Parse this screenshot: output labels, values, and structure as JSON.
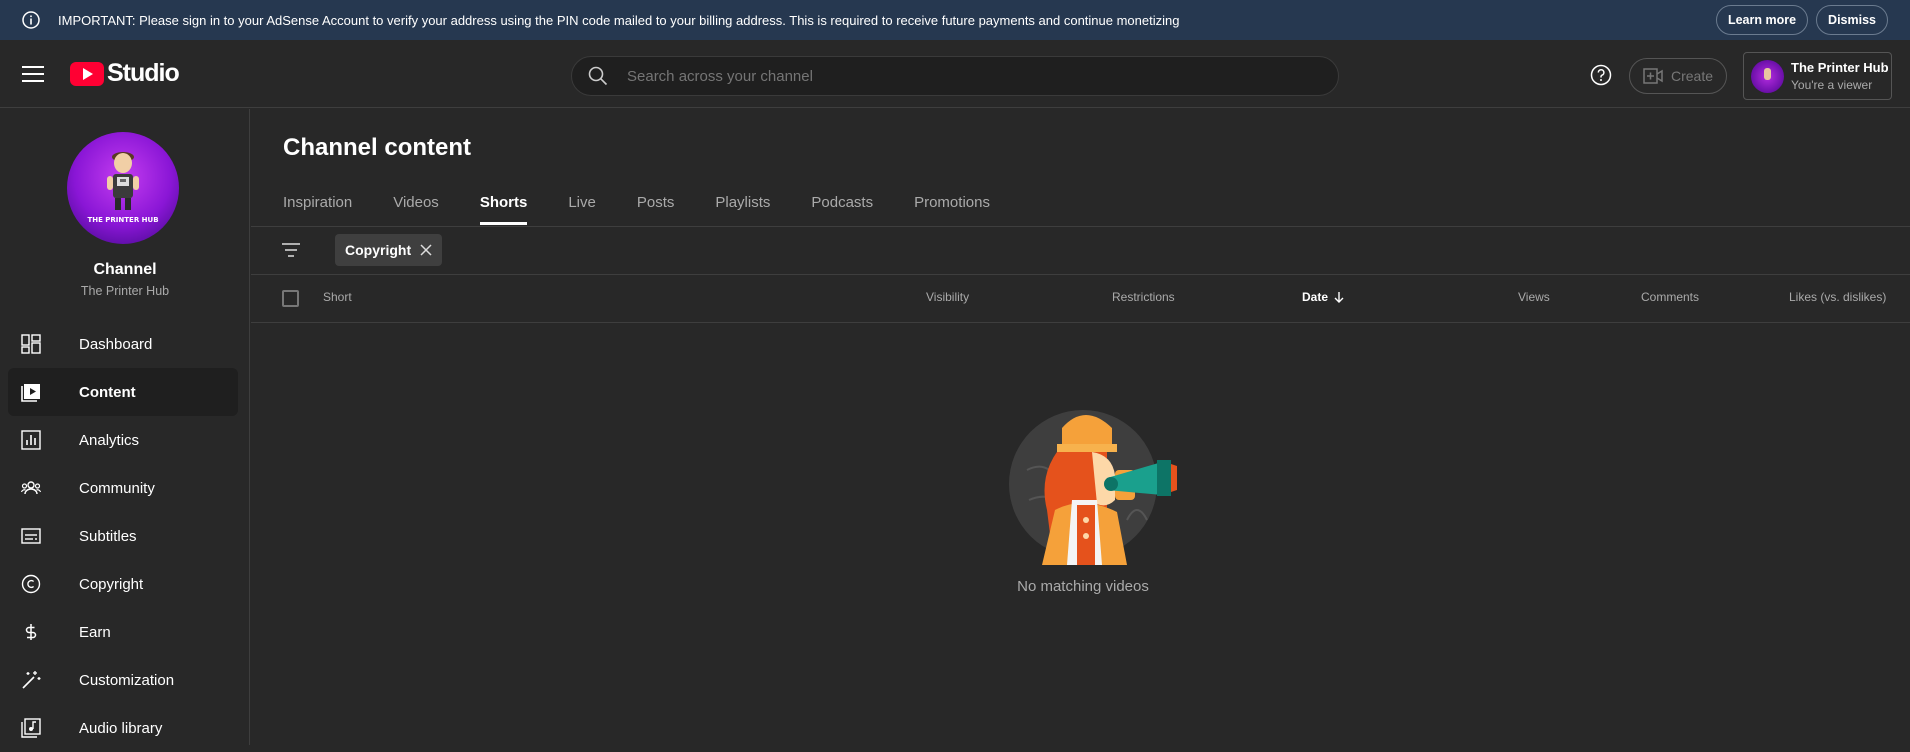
{
  "banner": {
    "text": "IMPORTANT: Please sign in to your AdSense Account to verify your address using the PIN code mailed to your billing address. This is required to receive future payments and continue monetizing",
    "learn_more": "Learn more",
    "dismiss": "Dismiss",
    "icon": "info-icon"
  },
  "header": {
    "logo_text": "Studio",
    "search_placeholder": "Search across your channel",
    "create_label": "Create",
    "account_name": "The Printer Hub",
    "account_role": "You're a viewer"
  },
  "sidebar": {
    "avatar_text": "THE PRINTER HUB",
    "channel_title": "Channel",
    "channel_name": "The Printer Hub",
    "items": [
      {
        "label": "Dashboard",
        "icon": "dashboard-icon"
      },
      {
        "label": "Content",
        "icon": "content-icon",
        "active": true
      },
      {
        "label": "Analytics",
        "icon": "analytics-icon"
      },
      {
        "label": "Community",
        "icon": "community-icon"
      },
      {
        "label": "Subtitles",
        "icon": "subtitles-icon"
      },
      {
        "label": "Copyright",
        "icon": "copyright-icon"
      },
      {
        "label": "Earn",
        "icon": "earn-icon"
      },
      {
        "label": "Customization",
        "icon": "customization-icon"
      },
      {
        "label": "Audio library",
        "icon": "audio-library-icon"
      }
    ]
  },
  "main": {
    "title": "Channel content",
    "tabs": [
      {
        "label": "Inspiration"
      },
      {
        "label": "Videos"
      },
      {
        "label": "Shorts",
        "active": true
      },
      {
        "label": "Live"
      },
      {
        "label": "Posts"
      },
      {
        "label": "Playlists"
      },
      {
        "label": "Podcasts"
      },
      {
        "label": "Promotions"
      }
    ],
    "filter_chip": "Copyright",
    "columns": {
      "short": "Short",
      "visibility": "Visibility",
      "restrictions": "Restrictions",
      "date": "Date",
      "views": "Views",
      "comments": "Comments",
      "likes": "Likes (vs. dislikes)"
    },
    "empty_text": "No matching videos"
  }
}
